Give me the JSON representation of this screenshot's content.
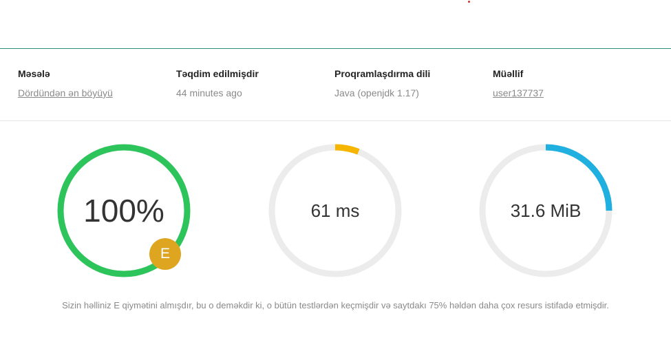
{
  "submission": {
    "problem": {
      "label": "Məsələ",
      "value": "Dördündən ən böyüyü"
    },
    "submitted": {
      "label": "Təqdim edilmişdir",
      "value": "44 minutes ago"
    },
    "language": {
      "label": "Proqramlaşdırma dili",
      "value": "Java (openjdk 1.17)"
    },
    "author": {
      "label": "Müəllif",
      "value": "user137737"
    }
  },
  "metrics": {
    "score": {
      "text": "100%",
      "fraction": 1.0,
      "color": "#2ec45c",
      "grade": "E",
      "grade_color": "#dea521"
    },
    "time": {
      "text": "61 ms",
      "fraction": 0.06,
      "color": "#f5b500"
    },
    "memory": {
      "text": "31.6 MiB",
      "fraction": 0.25,
      "color": "#1fb0e0"
    },
    "track_color": "#ececec"
  },
  "summary": "Sizin həlliniz E qiymətini almışdır, bu o deməkdir ki, o bütün testlərdən keçmişdir və saytdakı 75% həldən daha çox resurs istifadə etmişdir."
}
